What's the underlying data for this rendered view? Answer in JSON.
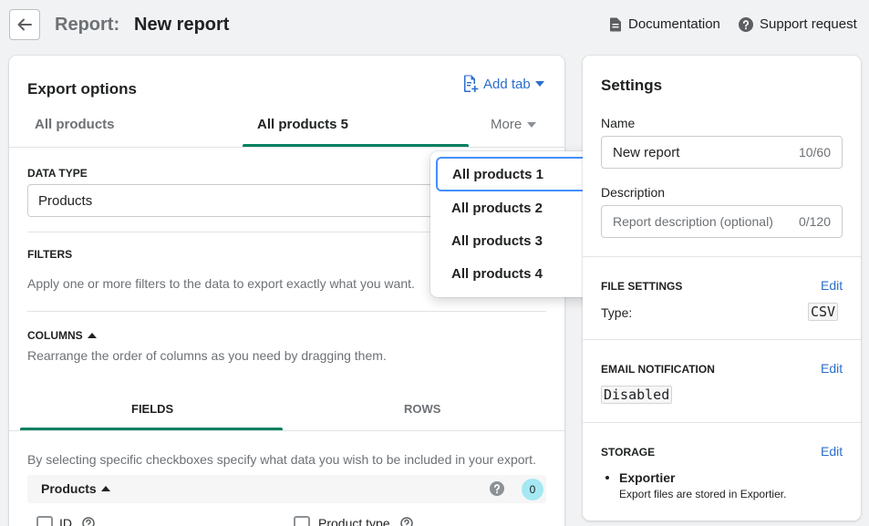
{
  "header": {
    "title_prefix": "Report:",
    "title_name": "New report",
    "documentation_label": "Documentation",
    "support_label": "Support request"
  },
  "export_options": {
    "title": "Export options",
    "add_tab_label": "Add tab",
    "tabs": [
      {
        "label": "All products",
        "active": false
      },
      {
        "label": "All products 5",
        "active": true
      }
    ],
    "more_label": "More",
    "more_menu": [
      "All products 1",
      "All products 2",
      "All products 3",
      "All products 4"
    ],
    "data_type": {
      "label": "DATA TYPE",
      "value": "Products"
    },
    "filters": {
      "label": "FILTERS",
      "description": "Apply one or more filters to the data to export exactly what you want."
    },
    "columns": {
      "label": "COLUMNS",
      "description": "Rearrange the order of columns as you need by dragging them."
    },
    "subtabs": [
      {
        "label": "FIELDS",
        "active": true
      },
      {
        "label": "ROWS",
        "active": false
      }
    ],
    "fields_description": "By selecting specific checkboxes specify what data you wish to be included in your export.",
    "group": {
      "label": "Products",
      "count": "0"
    },
    "fields": [
      "ID",
      "Product type"
    ]
  },
  "settings": {
    "title": "Settings",
    "name_label": "Name",
    "name_value": "New report",
    "name_count": "10/60",
    "description_label": "Description",
    "description_placeholder": "Report description (optional)",
    "description_count": "0/120",
    "file_settings": {
      "label": "FILE SETTINGS",
      "edit": "Edit",
      "type_label": "Type:",
      "type_value": "CSV"
    },
    "email_notification": {
      "label": "EMAIL NOTIFICATION",
      "edit": "Edit",
      "value": "Disabled"
    },
    "storage": {
      "label": "STORAGE",
      "edit": "Edit",
      "item_title": "Exportier",
      "item_description": "Export files are stored in Exportier."
    }
  },
  "colors": {
    "accent_green": "#008060",
    "link_blue": "#2c6ecb",
    "focus_blue": "#458fff",
    "badge_teal": "#a4e8f2"
  }
}
